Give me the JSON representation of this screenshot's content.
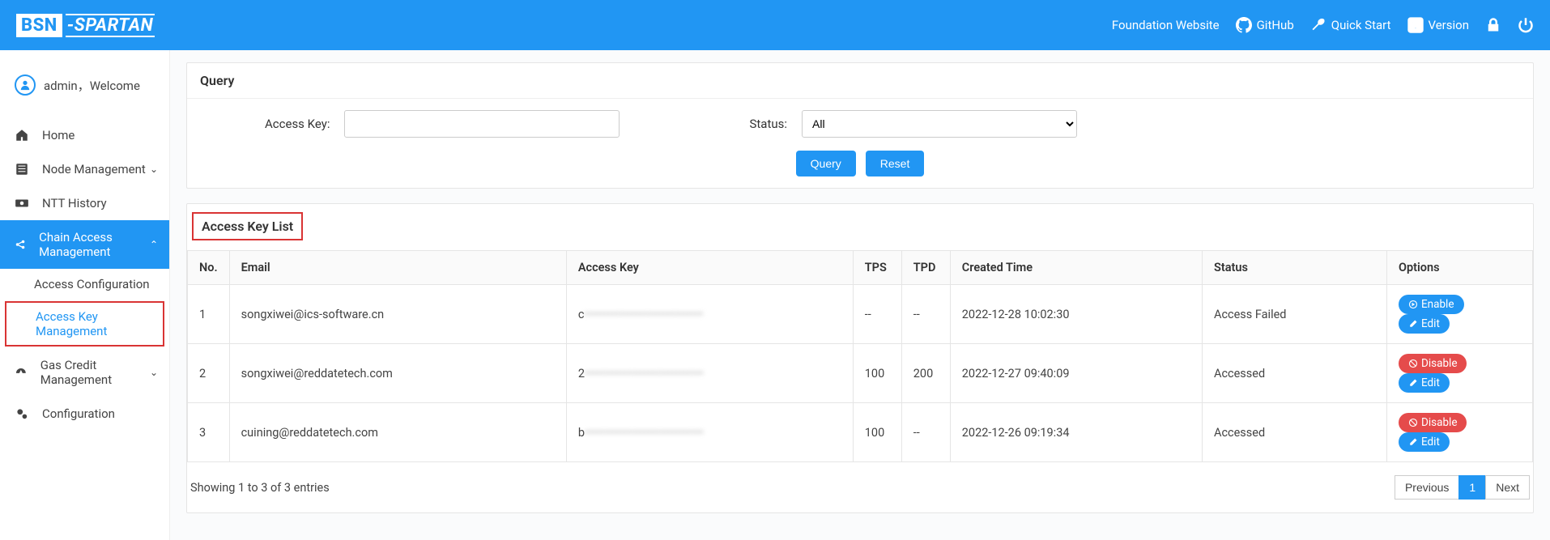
{
  "header": {
    "logo_left": "BSN",
    "logo_right": "-SPARTAN",
    "links": {
      "foundation": "Foundation Website",
      "github": "GitHub",
      "quickstart": "Quick Start",
      "version": "Version"
    }
  },
  "sidebar": {
    "user_label": "admin，Welcome",
    "items": {
      "home": "Home",
      "node_mgmt": "Node Management",
      "ntt_history": "NTT History",
      "chain_access": "Chain Access Management",
      "access_config": "Access Configuration",
      "access_key_mgmt": "Access Key Management",
      "gas_credit": "Gas Credit Management",
      "configuration": "Configuration"
    }
  },
  "query": {
    "title": "Query",
    "access_key_label": "Access Key:",
    "access_key_value": "",
    "status_label": "Status:",
    "status_selected": "All",
    "status_options": [
      "All"
    ],
    "query_btn": "Query",
    "reset_btn": "Reset"
  },
  "list": {
    "title": "Access Key List",
    "columns": {
      "no": "No.",
      "email": "Email",
      "access_key": "Access Key",
      "tps": "TPS",
      "tpd": "TPD",
      "created_time": "Created Time",
      "status": "Status",
      "options": "Options"
    },
    "rows": [
      {
        "no": "1",
        "email": "songxiwei@ics-software.cn",
        "access_key": "c••••••••••••••••••••••••••••••",
        "tps": "--",
        "tpd": "--",
        "created_time": "2022-12-28 10:02:30",
        "status": "Access Failed",
        "actions": [
          "enable",
          "edit"
        ]
      },
      {
        "no": "2",
        "email": "songxiwei@reddatetech.com",
        "access_key": "2••••••••••••••••••••••••••••••",
        "tps": "100",
        "tpd": "200",
        "created_time": "2022-12-27 09:40:09",
        "status": "Accessed",
        "actions": [
          "disable",
          "edit"
        ]
      },
      {
        "no": "3",
        "email": "cuining@reddatetech.com",
        "access_key": "b••••••••••••••••••••••••••••••",
        "tps": "100",
        "tpd": "--",
        "created_time": "2022-12-26 09:19:34",
        "status": "Accessed",
        "actions": [
          "disable",
          "edit"
        ]
      }
    ],
    "action_labels": {
      "enable": "Enable",
      "disable": "Disable",
      "edit": "Edit"
    },
    "footer_text": "Showing 1 to 3 of 3 entries",
    "pager": {
      "previous": "Previous",
      "next": "Next",
      "pages": [
        "1"
      ],
      "active": "1"
    }
  }
}
